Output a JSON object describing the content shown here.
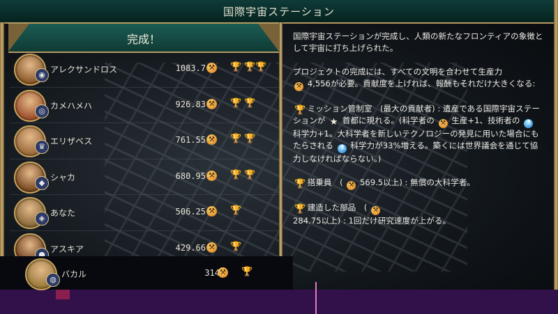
{
  "window": {
    "title": "国際宇宙ステーション"
  },
  "header": {
    "title": "完成！"
  },
  "players": [
    {
      "name": "アレクサンドロス",
      "score": "1083.7",
      "trophies": [
        "gold",
        "silver",
        "big"
      ],
      "portrait": "#8b5a2b",
      "emblem": "◉"
    },
    {
      "name": "カメハメハ",
      "score": "926.83",
      "trophies": [
        "gold",
        "silver"
      ],
      "portrait": "#a0522d",
      "emblem": "◎"
    },
    {
      "name": "エリザベス",
      "score": "761.55",
      "trophies": [
        "gold",
        "silver"
      ],
      "portrait": "#9c6b3c",
      "emblem": "♛"
    },
    {
      "name": "シャカ",
      "score": "680.95",
      "trophies": [
        "gold",
        "silver"
      ],
      "portrait": "#7a4a24",
      "emblem": "◆"
    },
    {
      "name": "あなた",
      "score": "506.25",
      "trophies": [
        "gold"
      ],
      "portrait": "#8a6a3a",
      "emblem": "◈"
    },
    {
      "name": "アスキア",
      "score": "429.66",
      "trophies": [
        "gold"
      ],
      "portrait": "#6e3e1e",
      "emblem": "●"
    },
    {
      "name": "バカル",
      "score": "314",
      "trophies": [
        "gold"
      ],
      "portrait": "#9a7a3a",
      "emblem": "◍"
    }
  ],
  "description": {
    "intro": "国際宇宙ステーションが完成し、人類の新たなフロンティアの象徴として宇宙に打ち上げられた。",
    "project_a": "プロジェクトの完成には、すべての文明を合わせて生産力",
    "project_b": "4,556が必要。貢献度を上げれば、報酬もそれだけ大きくなる:",
    "mission_a": "ミッション管制室　(最大の貢献者) : 遺産である国際宇宙ステーションが",
    "mission_b": "首都に現れる。(科学者の",
    "mission_c": "生産+1、技術者の",
    "mission_d": "科学力+1。大科学者を新しいテクノロジーの発見に用いた場合にもたらされる",
    "mission_e": "科学力が33%増える。築くには世界議会を通じて協力しなければならない。)",
    "crew_a": "搭乗員　(",
    "crew_b": "569.5以上) : 無償の大科学者。",
    "parts_a": "建造した部品　(",
    "parts_b": "284.75以上) : 1回だけ研究速度が上がる。"
  },
  "colors": {
    "teal": "#0f3b35",
    "gold_frame": "#b79a62",
    "production": "#d7781a",
    "science": "#1b7fd0"
  }
}
